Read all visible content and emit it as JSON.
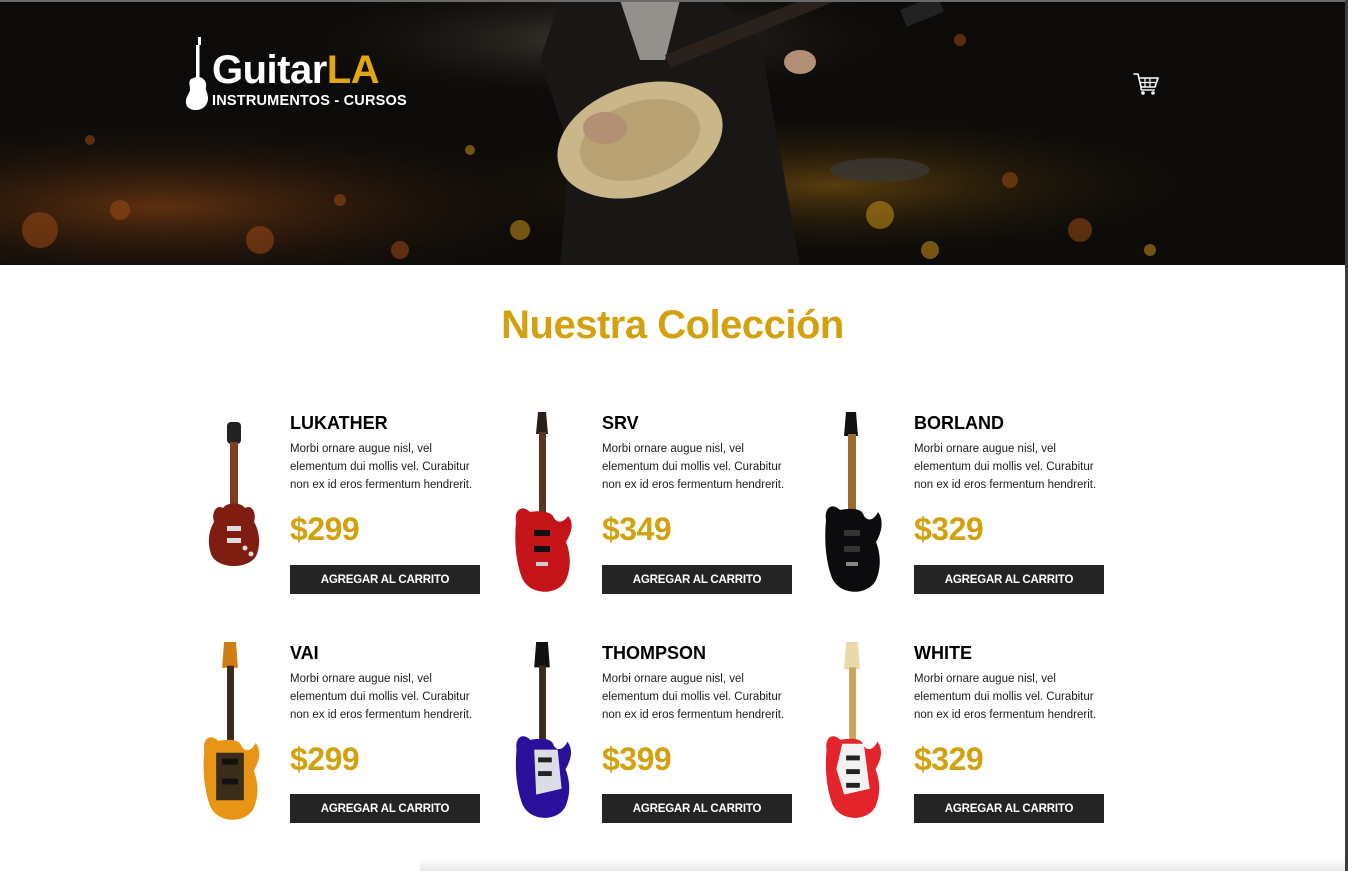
{
  "header": {
    "logo": {
      "name_part1": "Guitar",
      "name_part2": "LA",
      "tagline": "INSTRUMENTOS - CURSOS",
      "icon": "electric-guitar-silhouette-icon"
    },
    "cart_icon": "shopping-cart-icon"
  },
  "main": {
    "title": "Nuestra Colección",
    "products": [
      {
        "name": "LUKATHER",
        "description": "Morbi ornare augue nisl, vel elementum dui mollis vel. Curabitur non ex id eros fermentum hendrerit.",
        "price": "$299",
        "button_label": "Agregar al Carrito",
        "image": "guitar-lukather-image"
      },
      {
        "name": "SRV",
        "description": "Morbi ornare augue nisl, vel elementum dui mollis vel. Curabitur non ex id eros fermentum hendrerit.",
        "price": "$349",
        "button_label": "Agregar al Carrito",
        "image": "guitar-srv-image"
      },
      {
        "name": "BORLAND",
        "description": "Morbi ornare augue nisl, vel elementum dui mollis vel. Curabitur non ex id eros fermentum hendrerit.",
        "price": "$329",
        "button_label": "Agregar al Carrito",
        "image": "guitar-borland-image"
      },
      {
        "name": "VAI",
        "description": "Morbi ornare augue nisl, vel elementum dui mollis vel. Curabitur non ex id eros fermentum hendrerit.",
        "price": "$299",
        "button_label": "Agregar al Carrito",
        "image": "guitar-vai-image"
      },
      {
        "name": "THOMPSON",
        "description": "Morbi ornare augue nisl, vel elementum dui mollis vel. Curabitur non ex id eros fermentum hendrerit.",
        "price": "$399",
        "button_label": "Agregar al Carrito",
        "image": "guitar-thompson-image"
      },
      {
        "name": "WHITE",
        "description": "Morbi ornare augue nisl, vel elementum dui mollis vel. Curabitur non ex id eros fermentum hendrerit.",
        "price": "$329",
        "button_label": "Agregar al Carrito",
        "image": "guitar-white-image"
      }
    ]
  },
  "colors": {
    "accent": "#d4a10e",
    "button_bg": "#242424",
    "header_bg": "#0d0b09"
  }
}
